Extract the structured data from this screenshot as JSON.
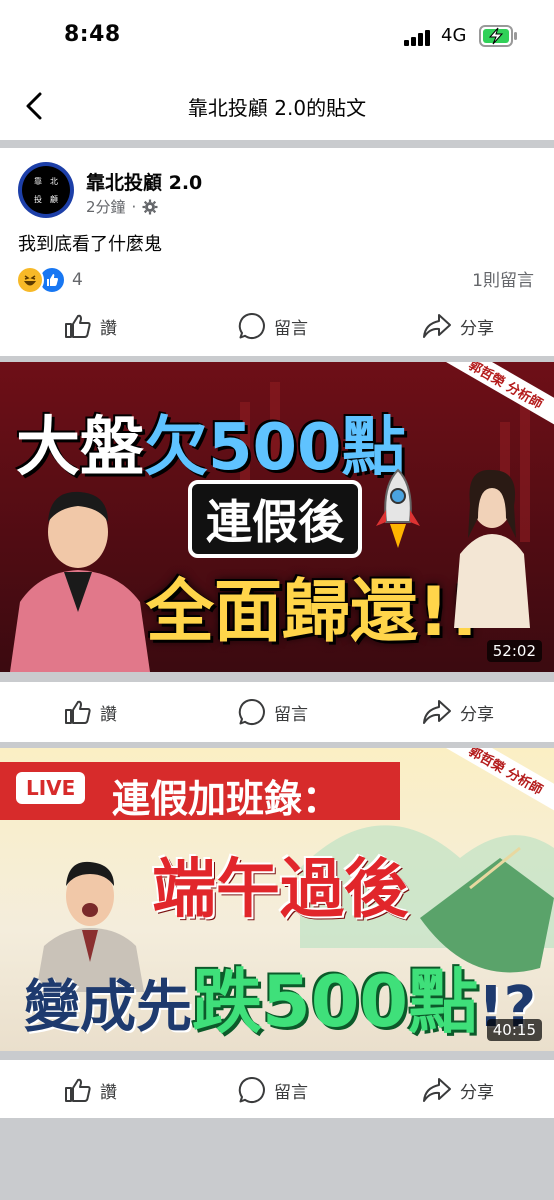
{
  "status": {
    "time": "8:48",
    "network": "4G"
  },
  "nav": {
    "title": "靠北投顧 2.0的貼文"
  },
  "post": {
    "avatar_text": [
      "靠",
      "北",
      "投",
      "顧"
    ],
    "author": "靠北投顧 2.0",
    "time": "2分鐘",
    "dot": "·",
    "text": "我到底看了什麼鬼",
    "reaction_count": "4",
    "comment_count": "1則留言"
  },
  "actions": {
    "like": "讚",
    "comment": "留言",
    "share": "分享"
  },
  "videos": [
    {
      "tag": "郭哲榮 分析師",
      "line1a": "大盤",
      "line1b": "欠500點",
      "line2": "連假後",
      "line3": "全面歸還!!",
      "duration": "52:02"
    },
    {
      "tag": "郭哲榮 分析師",
      "live": "LIVE",
      "line1": "連假加班錄：",
      "line2": "端午過後",
      "line3a": "變成先",
      "line3b": "跌500點",
      "line3c": "!?",
      "duration": "40:15"
    }
  ],
  "colors": {
    "accent": "#1877f2",
    "muted": "#65676b",
    "background": "#c9cbce"
  }
}
